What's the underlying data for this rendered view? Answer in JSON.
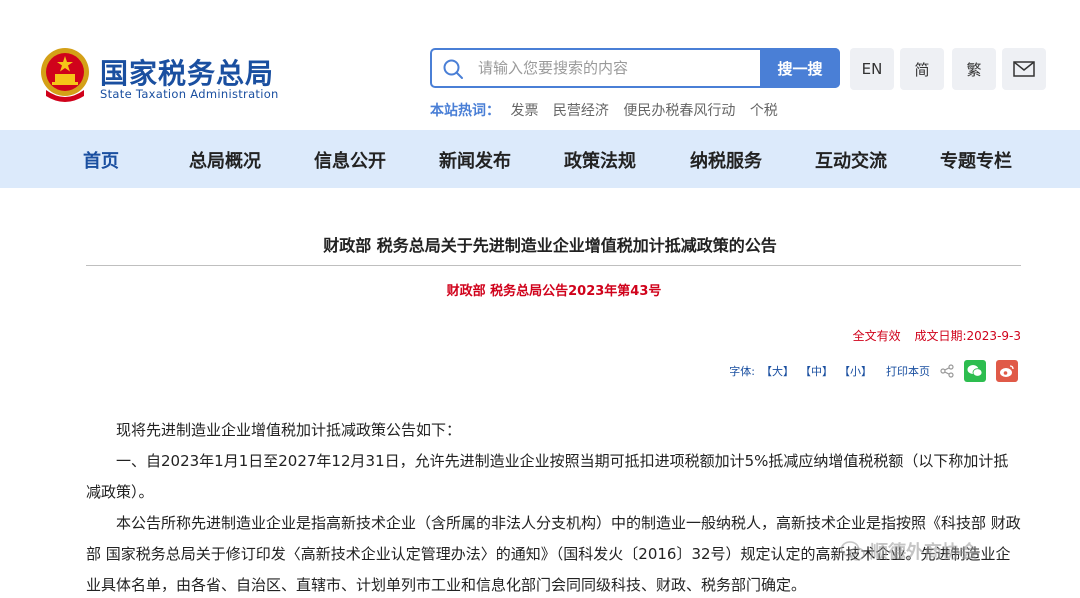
{
  "header": {
    "brand_cn": "国家税务总局",
    "brand_en": "State Taxation Administration",
    "search": {
      "placeholder": "请输入您要搜索的内容",
      "button_label": "搜一搜"
    },
    "lang_en": "EN",
    "lang_simplified": "简",
    "lang_traditional": "繁",
    "mail_icon": "mail-icon",
    "hot_label": "本站热词：",
    "hot_items": [
      "发票",
      "民营经济",
      "便民办税春风行动",
      "个税"
    ]
  },
  "nav": {
    "items": [
      "首页",
      "总局概况",
      "信息公开",
      "新闻发布",
      "政策法规",
      "纳税服务",
      "互动交流",
      "专题专栏"
    ],
    "active_index": 0
  },
  "article": {
    "title": "财政部  税务总局关于先进制造业企业增值税加计抵减政策的公告",
    "doc_number": "财政部  税务总局公告2023年第43号",
    "validity": "全文有效",
    "date": "成文日期:2023-9-3",
    "tools": {
      "font_label": "字体:",
      "large": "【大】",
      "medium": "【中】",
      "small": "【小】",
      "print": "打印本页"
    },
    "paragraphs": [
      "现将先进制造业企业增值税加计抵减政策公告如下：",
      "一、自2023年1月1日至2027年12月31日，允许先进制造业企业按照当期可抵扣进项税额加计5%抵减应纳增值税税额（以下称加计抵减政策）。",
      "本公告所称先进制造业企业是指高新技术企业（含所属的非法人分支机构）中的制造业一般纳税人，高新技术企业是指按照《科技部  财政部  国家税务总局关于修订印发〈高新技术企业认定管理办法〉的通知》（国科发火〔2016〕32号）规定认定的高新技术企业。先进制造业企业具体名单，由各省、自治区、直辖市、计划单列市工业和信息化部门会同同级科技、财政、税务部门确定。"
    ]
  },
  "watermark": "顺德外商协会",
  "colors": {
    "brand_blue": "#1a4fa0",
    "accent_blue": "#4a7fd6",
    "nav_bg": "#dceafb",
    "red": "#d0021b"
  }
}
